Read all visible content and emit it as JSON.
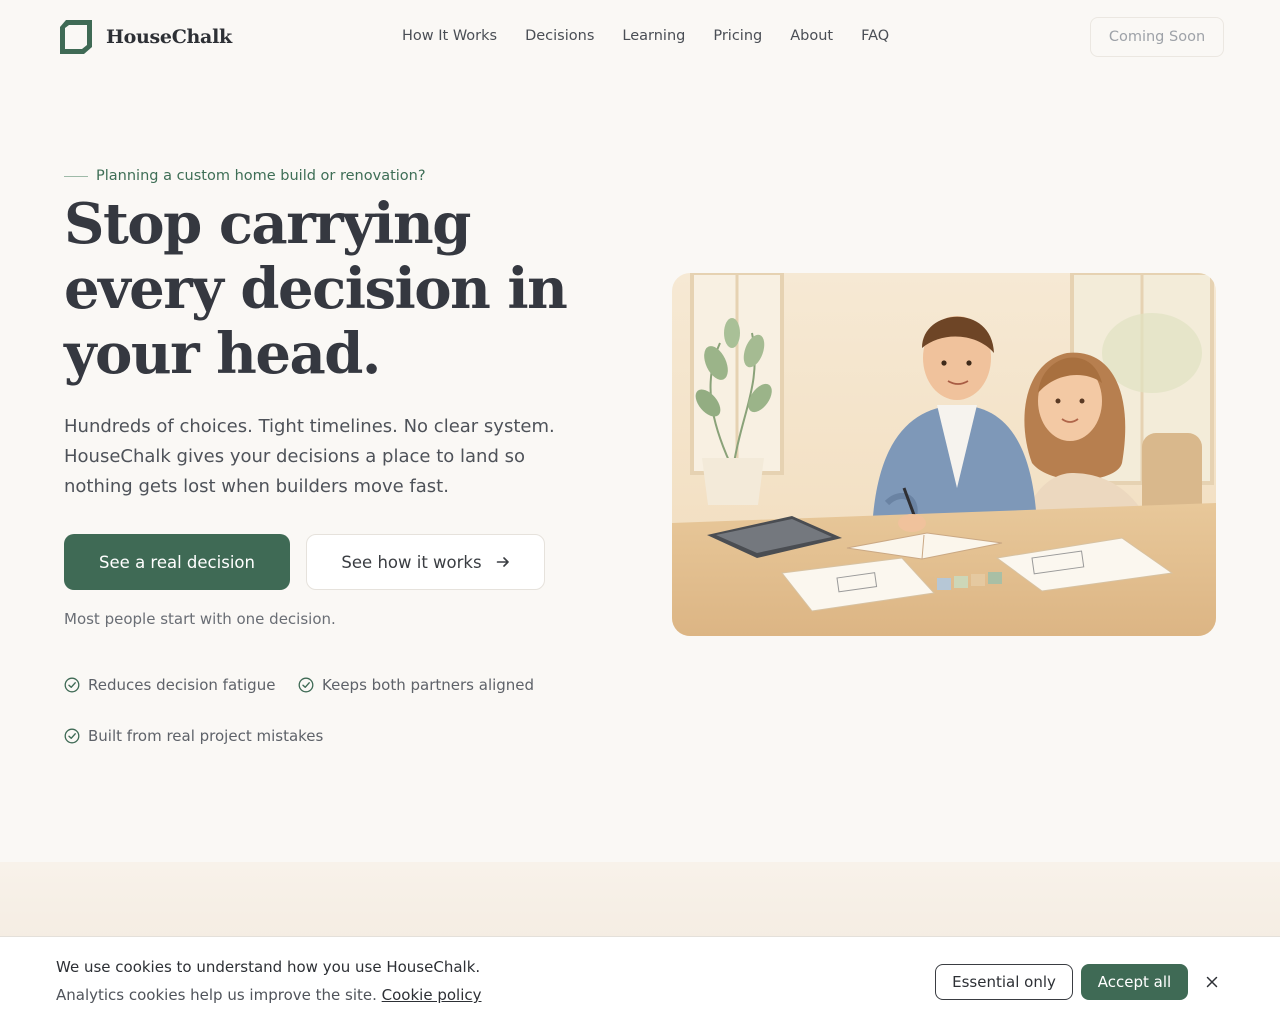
{
  "brand": {
    "name": "HouseChalk",
    "accent": "#3f6a55"
  },
  "nav": {
    "items": [
      {
        "label": "How It Works"
      },
      {
        "label": "Decisions"
      },
      {
        "label": "Learning"
      },
      {
        "label": "Pricing"
      },
      {
        "label": "About"
      },
      {
        "label": "FAQ"
      }
    ],
    "coming_soon": "Coming Soon"
  },
  "hero": {
    "eyebrow": "Planning a custom home build or renovation?",
    "headline": "Stop carrying every decision in your head.",
    "lead": "Hundreds of choices. Tight timelines. No clear system. HouseChalk gives your decisions a place to land so nothing gets lost when builders move fast.",
    "primary_cta": "See a real decision",
    "secondary_cta": "See how it works",
    "secondary_icon": "arrow-right-icon",
    "hint": "Most people start with one decision.",
    "features": [
      {
        "label": "Reduces decision fatigue",
        "icon": "check-circle-icon"
      },
      {
        "label": "Keeps both partners aligned",
        "icon": "check-circle-icon"
      },
      {
        "label": "Built from real project mistakes",
        "icon": "check-circle-icon"
      }
    ],
    "illustration": "couple-planning-illustration"
  },
  "cookie": {
    "title": "We use cookies to understand how you use HouseChalk.",
    "subtitle": "Analytics cookies help us improve the site.",
    "policy_link": "Cookie policy",
    "essential_label": "Essential only",
    "accept_label": "Accept all",
    "close_icon": "close-icon"
  }
}
